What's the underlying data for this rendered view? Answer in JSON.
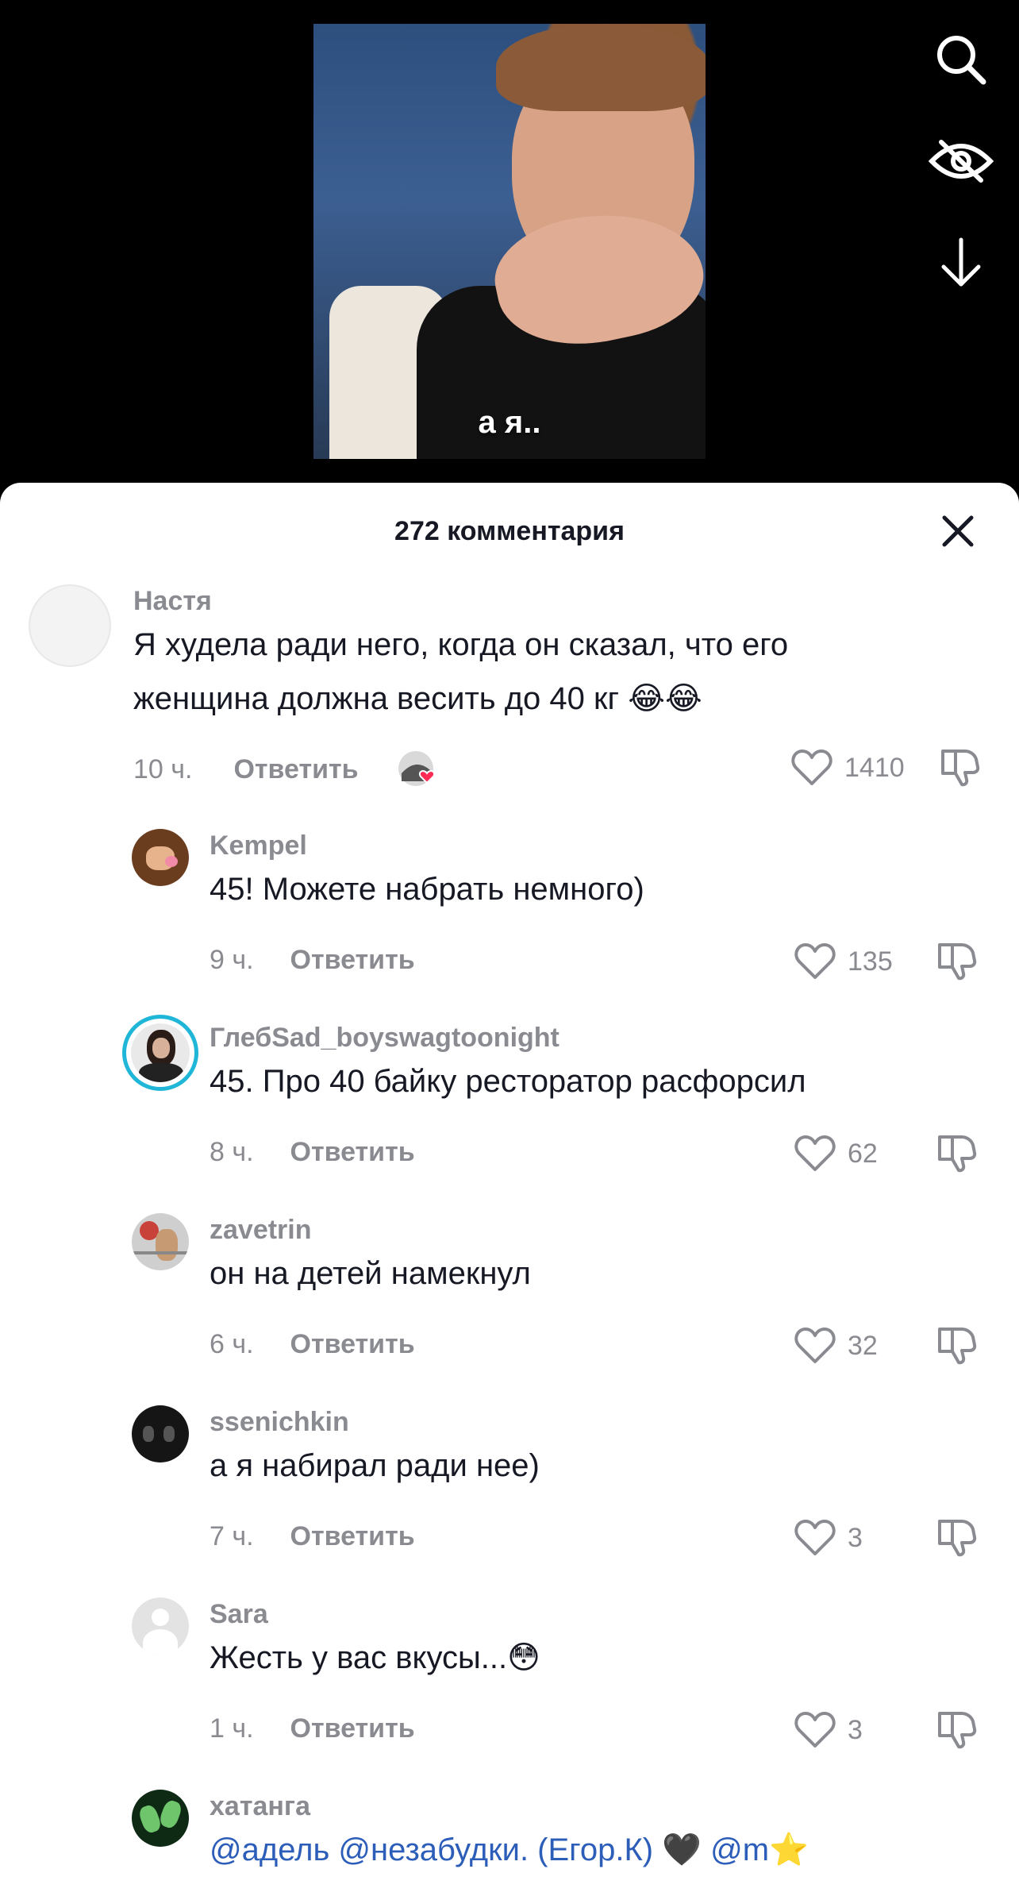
{
  "video": {
    "caption": "а я.."
  },
  "side_icons": [
    "search-icon",
    "hide-eye-icon",
    "arrow-down-icon"
  ],
  "sheet": {
    "title": "272 комментария"
  },
  "comments": [
    {
      "username": "Настя",
      "line1": "Я худела ради него, когда он сказал, что его",
      "line2": "женщина должна весить до 40 кг 😂😂",
      "time": "10 ч.",
      "reply": "Ответить",
      "likes": "1410"
    },
    {
      "username": "Kempel",
      "text": "45! Можете набрать немного)",
      "time": "9 ч.",
      "reply": "Ответить",
      "likes": "135"
    },
    {
      "username": "ГлебSad_boyswagtoonight",
      "text": "45. Про 40 байку ресторатор расфорсил",
      "time": "8 ч.",
      "reply": "Ответить",
      "likes": "62"
    },
    {
      "username": "zavetrin",
      "text": "он на детей намекнул",
      "time": "6 ч.",
      "reply": "Ответить",
      "likes": "32"
    },
    {
      "username": "ssenichkin",
      "text": "а я набирал ради нее)",
      "time": "7 ч.",
      "reply": "Ответить",
      "likes": "3"
    },
    {
      "username": "Sara",
      "text": "Жесть у вас вкусы...😳",
      "time": "1 ч.",
      "reply": "Ответить",
      "likes": "3"
    },
    {
      "username": "хатанга",
      "mentions": "@адель @незабудки. (Егор.К)",
      "heart": "🖤",
      "mention_tail": "@m",
      "star": "⭐"
    }
  ],
  "colors": {
    "accent_mention": "#2b5db9",
    "muted": "#8a8b91",
    "text": "#161823",
    "story_ring": "#1fb6d8"
  }
}
